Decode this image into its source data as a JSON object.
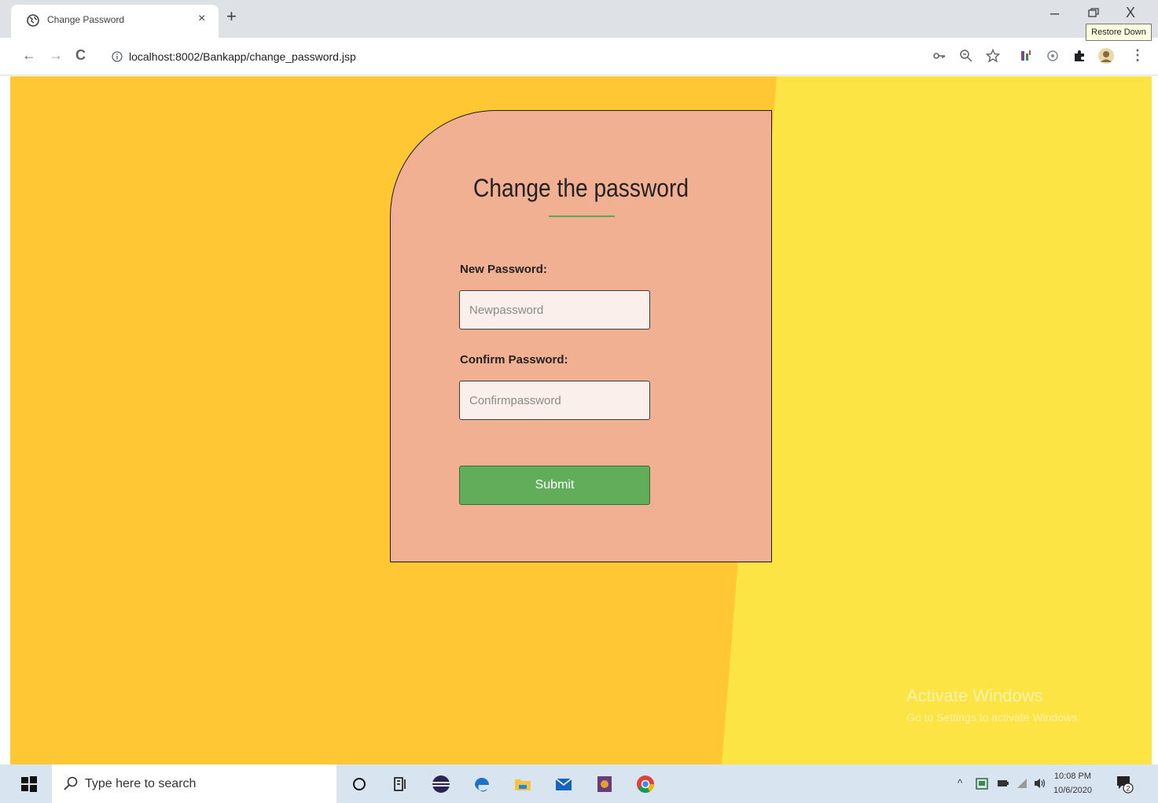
{
  "browser": {
    "tab": {
      "title": "Change Password",
      "close": "×"
    },
    "new_tab": "+",
    "window": {
      "minimize": "–",
      "close": "X",
      "tooltip": "Restore Down"
    },
    "nav": {
      "back": "←",
      "forward": "→",
      "reload": "C"
    },
    "url": "localhost:8002/Bankapp/change_password.jsp"
  },
  "page": {
    "title": "Change the password",
    "new_password": {
      "label": "New Password:",
      "placeholder": "Newpassword",
      "value": ""
    },
    "confirm_password": {
      "label": "Confirm Password:",
      "placeholder": "Confirmpassword",
      "value": ""
    },
    "submit_label": "Submit",
    "colors": {
      "background_left": "#fec733",
      "background_right": "#fde445",
      "card": "#f2b092",
      "submit": "#61ad5a",
      "underline": "#5aa85a"
    }
  },
  "watermark": {
    "title": "Activate Windows",
    "subtitle": "Go to Settings to activate Windows."
  },
  "taskbar": {
    "search_placeholder": "Type here to search",
    "clock_time": "10:08 PM",
    "clock_date": "10/6/2020",
    "notification_count": "2",
    "icons": [
      "cortana-icon",
      "task-view-icon",
      "eclipse-icon",
      "edge-icon",
      "file-explorer-icon",
      "mail-icon",
      "app-icon",
      "chrome-icon"
    ]
  }
}
